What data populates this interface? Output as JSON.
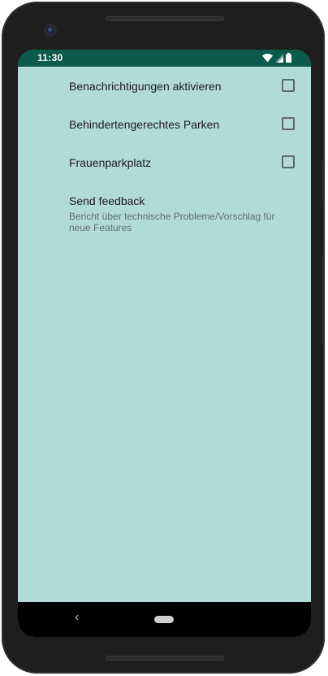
{
  "status_bar": {
    "time": "11:30",
    "icons": [
      "wifi-icon",
      "signal-icon",
      "battery-icon"
    ],
    "background": "#0b5a4b"
  },
  "preferences": [
    {
      "title": "Benachrichtigungen aktivieren",
      "type": "checkbox",
      "checked": false
    },
    {
      "title": "Behindertengerechtes Parken",
      "type": "checkbox",
      "checked": false
    },
    {
      "title": "Frauenparkplatz",
      "type": "checkbox",
      "checked": false
    },
    {
      "title": "Send feedback",
      "summary": "Bericht über technische Probleme/Vorschlag für neue Features",
      "type": "link"
    }
  ],
  "nav_bar": {
    "back_glyph": "‹",
    "icons": [
      "back-icon",
      "home-icon"
    ]
  },
  "colors": {
    "screen_background": "#b2dbd8",
    "status_bar": "#0b5a4b",
    "text_primary": "#1c1c1c",
    "text_secondary": "#5f6f6d"
  }
}
